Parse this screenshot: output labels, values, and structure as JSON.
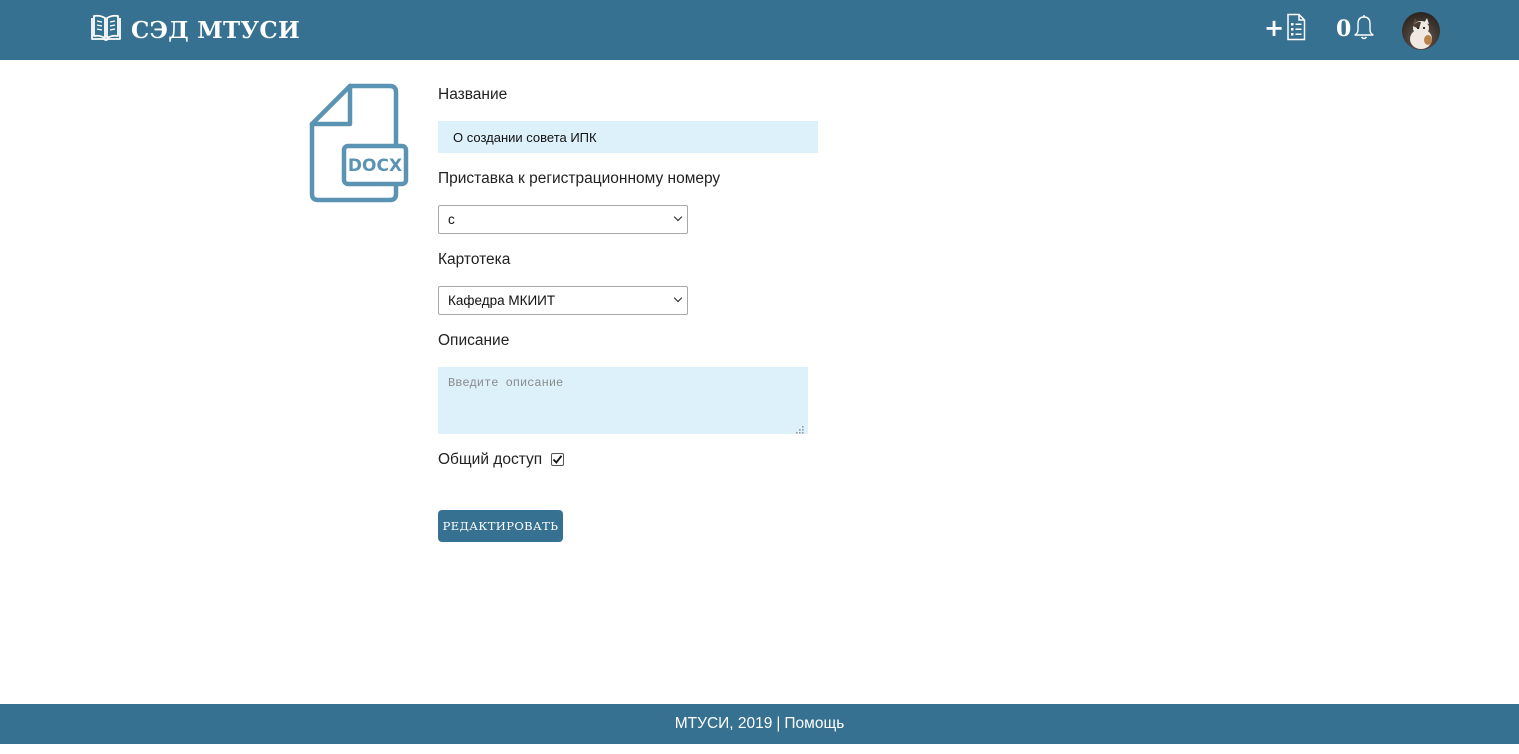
{
  "app": {
    "title": "СЭД МТУСИ"
  },
  "header": {
    "notifications_count": "0"
  },
  "document": {
    "file_type": "DOCX"
  },
  "form": {
    "title_label": "Название",
    "title_value": "О создании совета ИПК",
    "prefix_label": "Приставка к регистрационному номеру",
    "prefix_value": "с",
    "cardindex_label": "Картотека",
    "cardindex_value": "Кафедра МКИИТ",
    "description_label": "Описание",
    "description_placeholder": "Введите описание",
    "shared_label": "Общий доступ",
    "shared_checked": true,
    "edit_button": "РЕДАКТИРОВАТЬ"
  },
  "footer": {
    "copyright": "МТУСИ, 2019",
    "separator": "|",
    "help_link": "Помощь"
  },
  "colors": {
    "header_bg": "#367191",
    "input_bg": "#ddf1fb",
    "doc_icon": "#5b93b2"
  }
}
